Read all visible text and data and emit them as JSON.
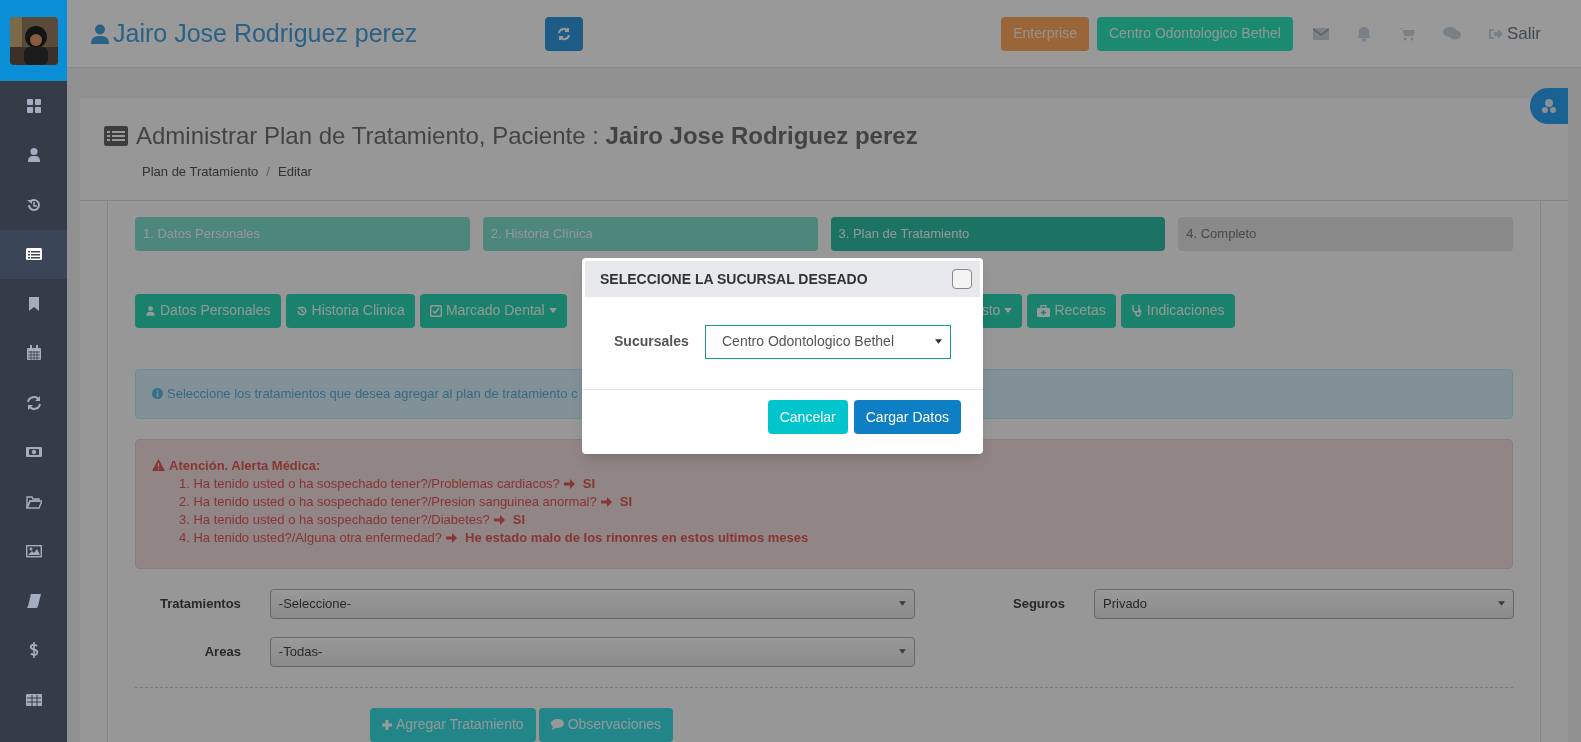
{
  "sidebar": {
    "items": [
      {
        "selected": false
      },
      {
        "selected": false
      },
      {
        "selected": false
      },
      {
        "selected": true
      },
      {
        "selected": false
      },
      {
        "selected": false
      },
      {
        "selected": false
      },
      {
        "selected": false
      },
      {
        "selected": false
      },
      {
        "selected": false
      },
      {
        "selected": false
      },
      {
        "selected": false
      },
      {
        "selected": false
      }
    ]
  },
  "header": {
    "user_name": "Jairo Jose Rodriguez perez",
    "plan_badge": "Enterprise",
    "clinic_button": "Centro Odontologico Bethel",
    "logout": "Salir"
  },
  "page": {
    "title": "Administrar Plan de Tratamiento, Paciente : **Jairo Jose Rodriguez perez**",
    "breadcrumb": [
      "Plan de Tratamiento",
      "Editar"
    ],
    "breadcrumb_separator": "/"
  },
  "steps": [
    {
      "label": "1. Datos Personales",
      "kind": "done"
    },
    {
      "label": "2. Historia Clínica",
      "kind": "done"
    },
    {
      "label": "3. Plan de Tratamiento",
      "kind": "current"
    },
    {
      "label": "4. Completo",
      "kind": "pending"
    }
  ],
  "toolbar": [
    {
      "label": "Datos Personales",
      "dropdown": false
    },
    {
      "label": "Historia Clinica",
      "dropdown": false
    },
    {
      "label": "Marcado Dental",
      "dropdown": true
    },
    {
      "label": "sto",
      "dropdown": true
    },
    {
      "label": "Recetas",
      "dropdown": false
    },
    {
      "label": "Indicaciones",
      "dropdown": false
    }
  ],
  "info_alert": "Seleccione los tratamientos que desea agregar al plan de tratamiento c",
  "medical_alert": {
    "title": "Atención. Alerta Médica:",
    "items": [
      {
        "question": "1. Ha tenido usted o ha sospechado tener?/Problemas cardiacos?",
        "answer": "SI"
      },
      {
        "question": "2. Ha tenido usted o ha sospechado tener?/Presion sanguinea anormal?",
        "answer": "SI"
      },
      {
        "question": "3. Ha tenido usted o ha sospechado tener?/Diabetes?",
        "answer": "SI"
      },
      {
        "question": "4. Ha tenido usted?/Alguna otra enfermedad?",
        "answer": "He estado malo de los rinonres en estos ultimos meses"
      }
    ]
  },
  "form": {
    "tratamientos": {
      "label": "Tratamientos",
      "value": "-Seleccione-"
    },
    "seguros": {
      "label": "Seguros",
      "value": "Privado"
    },
    "areas": {
      "label": "Areas",
      "value": "-Todas-"
    }
  },
  "actions": [
    "Agregar Tratamiento",
    "Observaciones"
  ],
  "modal": {
    "title": "SELECCIONE LA SUCURSAL DESEADO",
    "field_label": "Sucursales",
    "value": "Centro Odontologico Bethel",
    "buttons": [
      {
        "label": "Cancelar",
        "kind": "secondary"
      },
      {
        "label": "Cargar Datos",
        "kind": "primary"
      }
    ]
  }
}
